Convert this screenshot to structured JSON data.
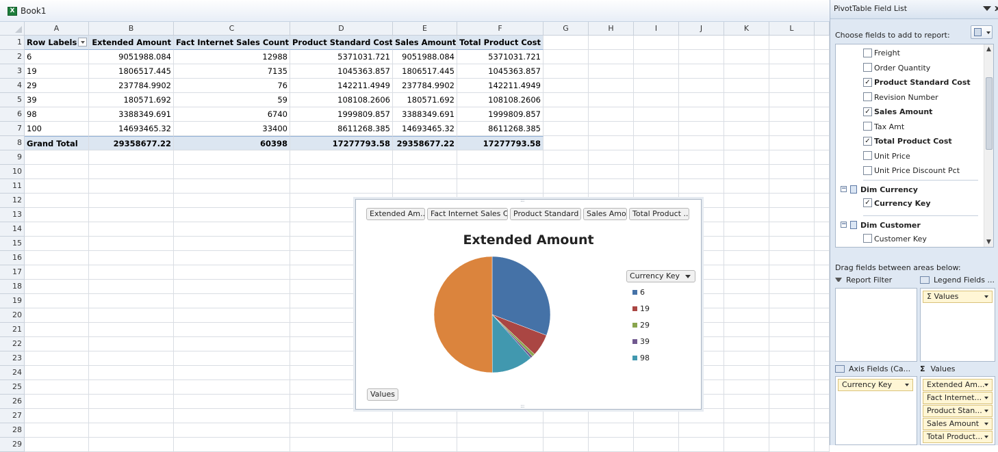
{
  "workbook": {
    "title": "Book1",
    "columns": [
      "A",
      "B",
      "C",
      "D",
      "E",
      "F",
      "G",
      "H",
      "I",
      "J",
      "K",
      "L"
    ],
    "row_numbers": [
      "1",
      "2",
      "3",
      "4",
      "5",
      "6",
      "7",
      "8",
      "9",
      "10",
      "11",
      "12",
      "13",
      "14",
      "15",
      "16",
      "17",
      "18",
      "19",
      "20",
      "21",
      "22",
      "23",
      "24",
      "25",
      "26",
      "27",
      "28",
      "29"
    ],
    "pivot": {
      "headers": [
        "Row Labels",
        "Extended Amount",
        "Fact Internet Sales Count",
        "Product Standard Cost",
        "Sales Amount",
        "Total Product Cost"
      ],
      "rows": [
        [
          "6",
          "9051988.084",
          "12988",
          "5371031.721",
          "9051988.084",
          "5371031.721"
        ],
        [
          "19",
          "1806517.445",
          "7135",
          "1045363.857",
          "1806517.445",
          "1045363.857"
        ],
        [
          "29",
          "237784.9902",
          "76",
          "142211.4949",
          "237784.9902",
          "142211.4949"
        ],
        [
          "39",
          "180571.692",
          "59",
          "108108.2606",
          "180571.692",
          "108108.2606"
        ],
        [
          "98",
          "3388349.691",
          "6740",
          "1999809.857",
          "3388349.691",
          "1999809.857"
        ],
        [
          "100",
          "14693465.32",
          "33400",
          "8611268.385",
          "14693465.32",
          "8611268.385"
        ]
      ],
      "total": [
        "Grand Total",
        "29358677.22",
        "60398",
        "17277793.58",
        "29358677.22",
        "17277793.58"
      ]
    }
  },
  "chart": {
    "field_buttons": [
      "Extended Am...",
      "Fact Internet Sales C...",
      "Product Standard ...",
      "Sales Amo...",
      "Total Product ..."
    ],
    "legend_button": "Currency Key",
    "values_button": "Values",
    "colors": {
      "6": "#4572a7",
      "19": "#aa4643",
      "29": "#89a54e",
      "39": "#71588f",
      "98": "#4198af",
      "100": "#db843d"
    }
  },
  "chart_data": {
    "type": "pie",
    "title": "Extended Amount",
    "categories": [
      "6",
      "19",
      "29",
      "39",
      "98",
      "100"
    ],
    "values": [
      9051988.084,
      1806517.445,
      237784.9902,
      180571.692,
      3388349.691,
      14693465.32
    ],
    "legend_visible": [
      "6",
      "19",
      "29",
      "39",
      "98"
    ],
    "legend_position": "right"
  },
  "pane": {
    "title": "PivotTable Field List",
    "choose_label": "Choose fields to add to report:",
    "fields": [
      {
        "label": "Freight",
        "checked": false
      },
      {
        "label": "Order Quantity",
        "checked": false
      },
      {
        "label": "Product Standard Cost",
        "checked": true
      },
      {
        "label": "Revision Number",
        "checked": false
      },
      {
        "label": "Sales Amount",
        "checked": true
      },
      {
        "label": "Tax Amt",
        "checked": false
      },
      {
        "label": "Total Product Cost",
        "checked": true
      },
      {
        "label": "Unit Price",
        "checked": false
      },
      {
        "label": "Unit Price Discount Pct",
        "checked": false
      }
    ],
    "groups": [
      {
        "label": "Dim Currency",
        "fields": [
          {
            "label": "Currency Key",
            "checked": true
          }
        ]
      },
      {
        "label": "Dim Customer",
        "fields": [
          {
            "label": "Customer Key",
            "checked": false
          }
        ]
      }
    ],
    "drag_label": "Drag fields between areas below:",
    "areas": {
      "report_filter": "Report Filter",
      "legend_fields": "Legend Fields ...",
      "axis_fields": "Axis Fields (Ca...",
      "values": "Values"
    },
    "legend_items": [
      "Values"
    ],
    "axis_items": [
      "Currency Key"
    ],
    "value_items": [
      "Extended Am...",
      "Fact Internet...",
      "Product Stan...",
      "Sales Amount",
      "Total Product..."
    ]
  }
}
